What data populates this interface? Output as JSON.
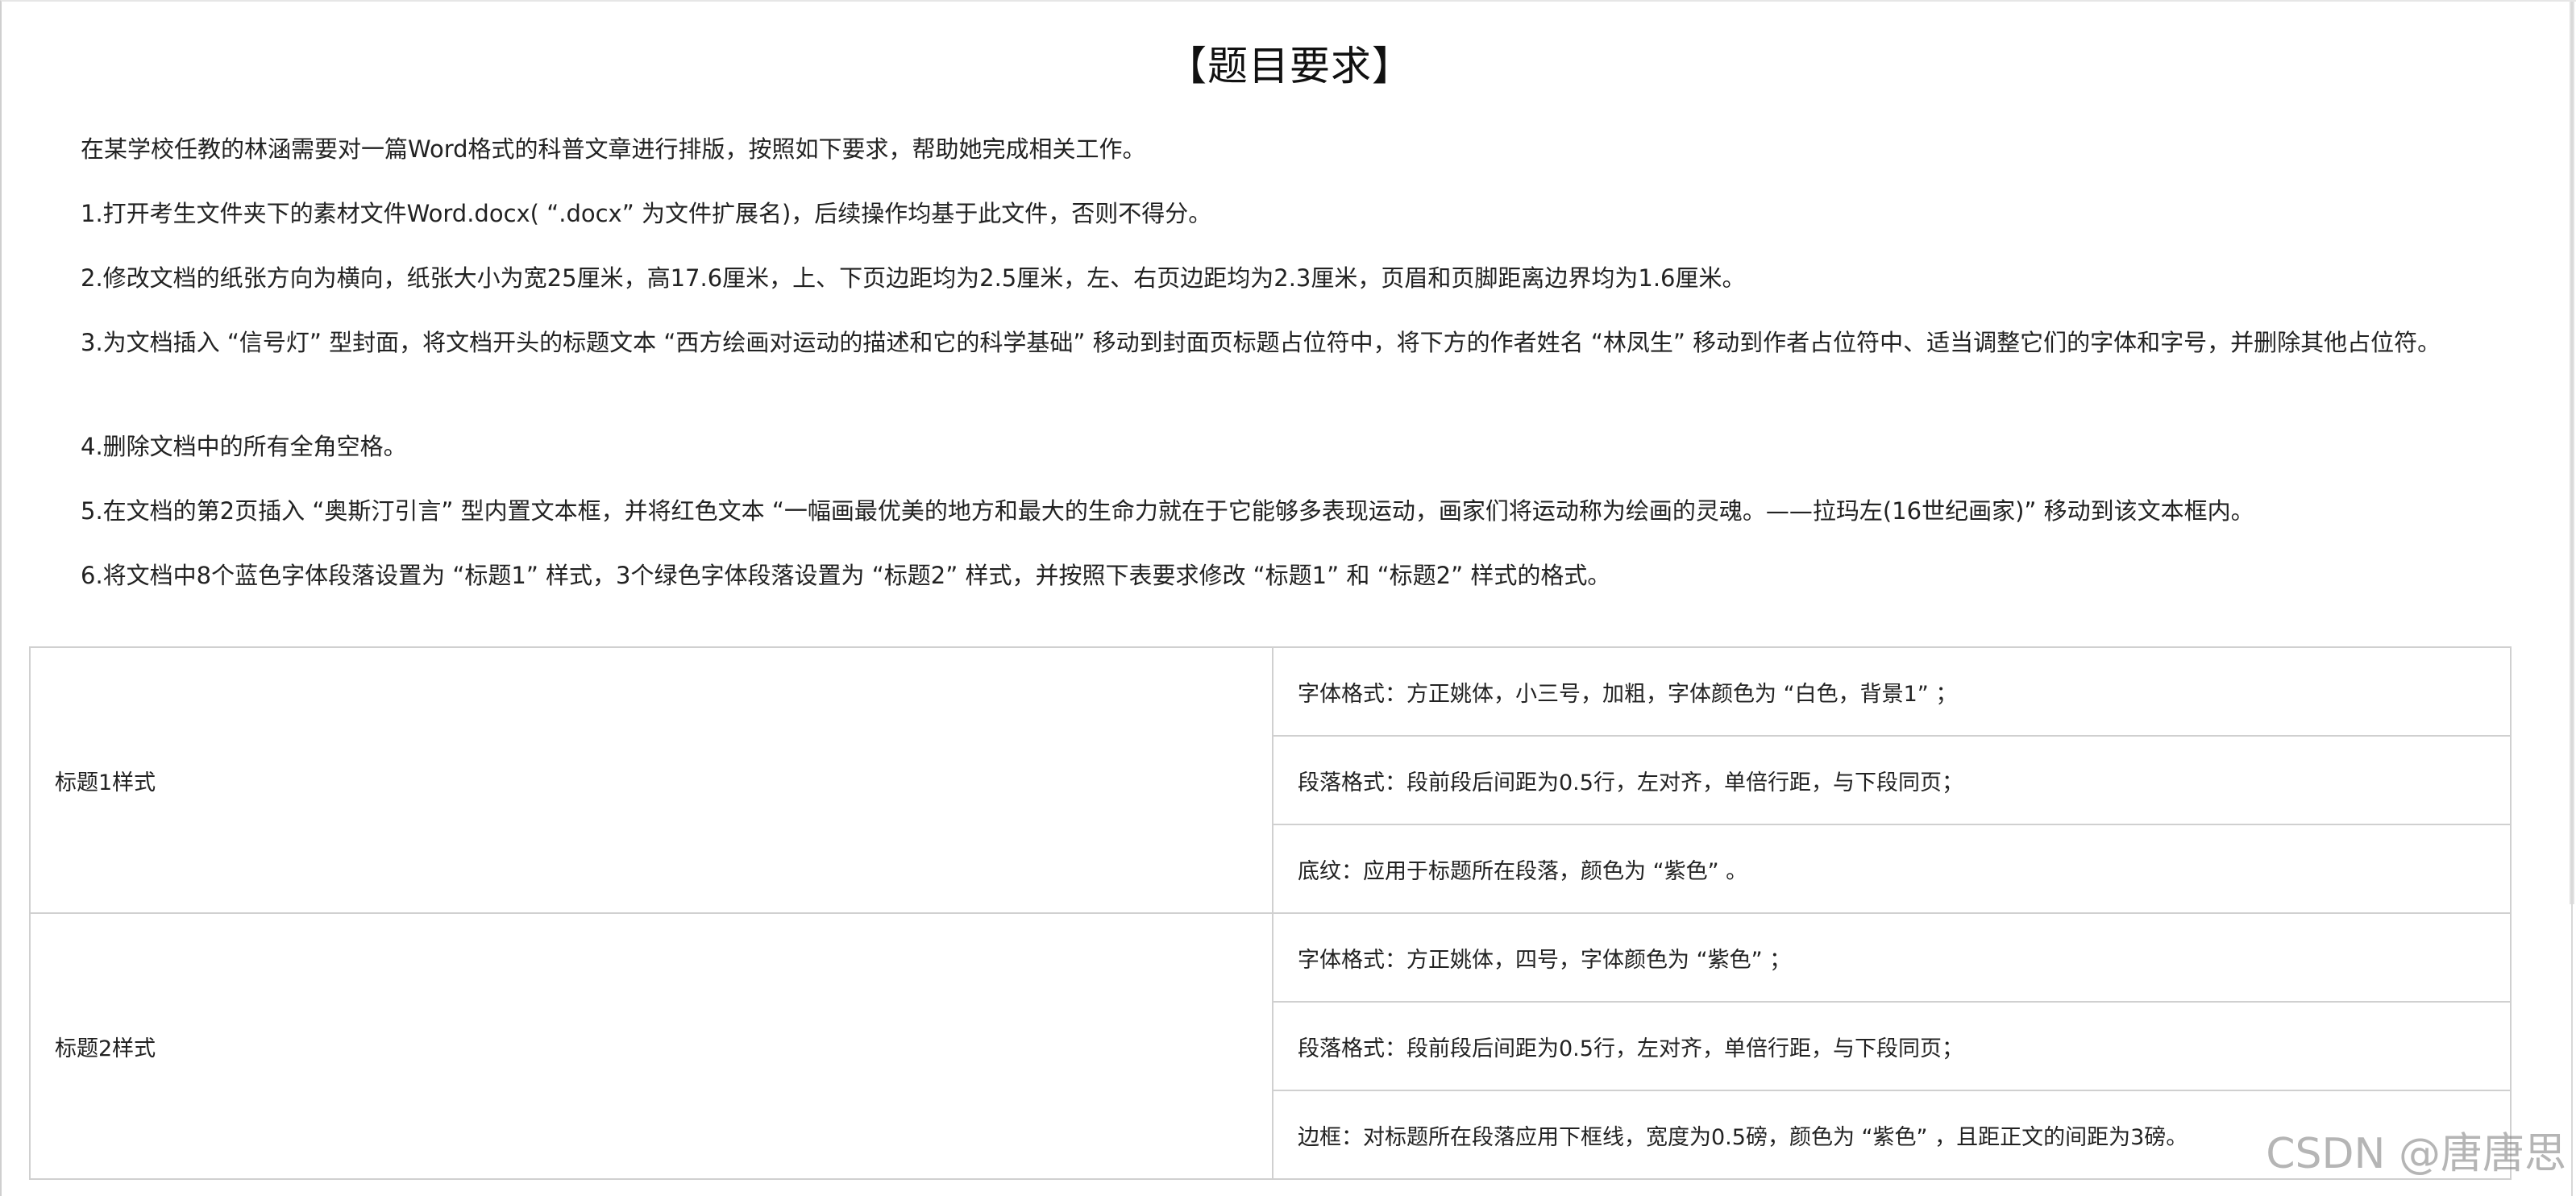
{
  "title": "【题目要求】",
  "paragraphs": [
    "在某学校任教的林涵需要对一篇Word格式的科普文章进行排版，按照如下要求，帮助她完成相关工作。",
    "1.打开考生文件夹下的素材文件Word.docx( “.docx” 为文件扩展名)，后续操作均基于此文件，否则不得分。",
    "2.修改文档的纸张方向为横向，纸张大小为宽25厘米，高17.6厘米，上、下页边距均为2.5厘米，左、右页边距均为2.3厘米，页眉和页脚距离边界均为1.6厘米。",
    "3.为文档插入 “信号灯” 型封面，将文档开头的标题文本 “西方绘画对运动的描述和它的科学基础” 移动到封面页标题占位符中，将下方的作者姓名 “林凤生” 移动到作者占位符中、适当调整它们的字体和字号，并删除其他占位符。",
    "4.删除文档中的所有全角空格。",
    "5.在文档的第2页插入 “奥斯汀引言” 型内置文本框，并将红色文本 “一幅画最优美的地方和最大的生命力就在于它能够多表现运动，画家们将运动称为绘画的灵魂。——拉玛左(16世纪画家)” 移动到该文本框内。",
    "6.将文档中8个蓝色字体段落设置为 “标题1” 样式，3个绿色字体段落设置为 “标题2” 样式，并按照下表要求修改 “标题1” 和 “标题2” 样式的格式。"
  ],
  "table": {
    "heading1": {
      "name": "标题1样式",
      "rows": [
        "字体格式：方正姚体，小三号，加粗，字体颜色为 “白色，背景1” ；",
        "段落格式：段前段后间距为0.5行，左对齐，单倍行距，与下段同页；",
        "底纹：应用于标题所在段落，颜色为 “紫色” 。"
      ]
    },
    "heading2": {
      "name": "标题2样式",
      "rows": [
        "字体格式：方正姚体，四号，字体颜色为 “紫色” ；",
        "段落格式：段前段后间距为0.5行，左对齐，单倍行距，与下段同页；",
        "边框：对标题所在段落应用下框线，宽度为0.5磅，颜色为 “紫色” ，且距正文的间距为3磅。"
      ]
    }
  },
  "watermark": "CSDN @唐唐思"
}
